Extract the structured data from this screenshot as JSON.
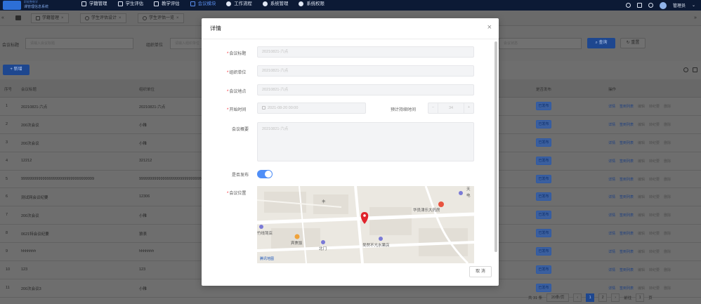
{
  "app": {
    "logo_line1": "职能整教学",
    "logo_line2": "课管理信息系统",
    "nav": [
      {
        "label": "学籍管理",
        "icon": "folder-icon"
      },
      {
        "label": "学生评估",
        "icon": "folder-icon"
      },
      {
        "label": "教学评估",
        "icon": "edit-icon"
      },
      {
        "label": "会议模块",
        "icon": "meeting-icon"
      },
      {
        "label": "工作流程",
        "icon": "share-icon"
      },
      {
        "label": "系统管理",
        "icon": "gear-icon"
      },
      {
        "label": "系统权限",
        "icon": "gear-icon"
      }
    ],
    "user": "管理员"
  },
  "tabs": [
    {
      "label": "学籍管理"
    },
    {
      "label": "学生评估设计"
    },
    {
      "label": "学生评估一览"
    }
  ],
  "search": {
    "label1": "会议标题",
    "placeholder1": "请输入会议标题",
    "label2": "组织单位",
    "placeholder2": "请输入组织单位",
    "placeholder3": "会议状态",
    "query": "查询",
    "reset": "重置"
  },
  "toolbar": {
    "add": "新增"
  },
  "table": {
    "headers": [
      "序号",
      "会议标题",
      "组织单位",
      "是否发布",
      "操作"
    ],
    "rows": [
      {
        "no": "1",
        "title": "20210821-六点",
        "org": "20210821-六点",
        "status": "已发布"
      },
      {
        "no": "2",
        "title": "200次会议",
        "org": "小稚",
        "status": "已发布"
      },
      {
        "no": "3",
        "title": "200次会议",
        "org": "小稚",
        "status": "已发布"
      },
      {
        "no": "4",
        "title": "12212",
        "org": "321212",
        "status": "已发布"
      },
      {
        "no": "5",
        "title": "9999999999999999999999999999999999",
        "org": "9999999999999999999999999999999999",
        "status": "已发布"
      },
      {
        "no": "6",
        "title": "测试网会议纪要",
        "org": "12306",
        "status": "已发布"
      },
      {
        "no": "7",
        "title": "200次会议",
        "org": "小稚",
        "status": "已发布"
      },
      {
        "no": "8",
        "title": "0621特会议纪要",
        "org": "狼表",
        "status": "已发布"
      },
      {
        "no": "9",
        "title": "hhhhhhh",
        "org": "hhhhhhh",
        "status": "已发布"
      },
      {
        "no": "10",
        "title": "123",
        "org": "123",
        "status": "已发布"
      },
      {
        "no": "11",
        "title": "200次会议3",
        "org": "小稚",
        "status": "已发布"
      }
    ],
    "ops": [
      "详情",
      "签到列表",
      "编辑",
      "转纪要",
      "删除"
    ]
  },
  "pager": {
    "total": "共 31 条",
    "size": "20条/页",
    "pages": [
      "1",
      "2"
    ],
    "goto": "前往",
    "page": "1",
    "unit": "页"
  },
  "modal": {
    "title": "详情",
    "fields": {
      "meeting_title_label": "会议标题",
      "meeting_title_value": "20210821-六点",
      "org_label": "组织单位",
      "org_value": "20210821-六点",
      "location_label": "会议地点",
      "location_value": "20210821-六点",
      "start_label": "开始时间",
      "start_value": "2021-08-20 00:00",
      "duration_label": "预计持续时间",
      "duration_value": "34",
      "summary_label": "会议概要",
      "summary_value": "20210821-六点",
      "publish_label": "是否发布",
      "publish_on": true,
      "position_label": "会议位置"
    },
    "map": {
      "poi1": "华员津乐大药房",
      "poi2": "天",
      "poi3": "电",
      "poi4": "丰",
      "poi5": "竹线驾店",
      "poi6": "宾焦饭",
      "poi7": "北门",
      "poi8": "吴然不亢水果店",
      "brand": "腾讯地图"
    },
    "cancel": "取 消"
  }
}
